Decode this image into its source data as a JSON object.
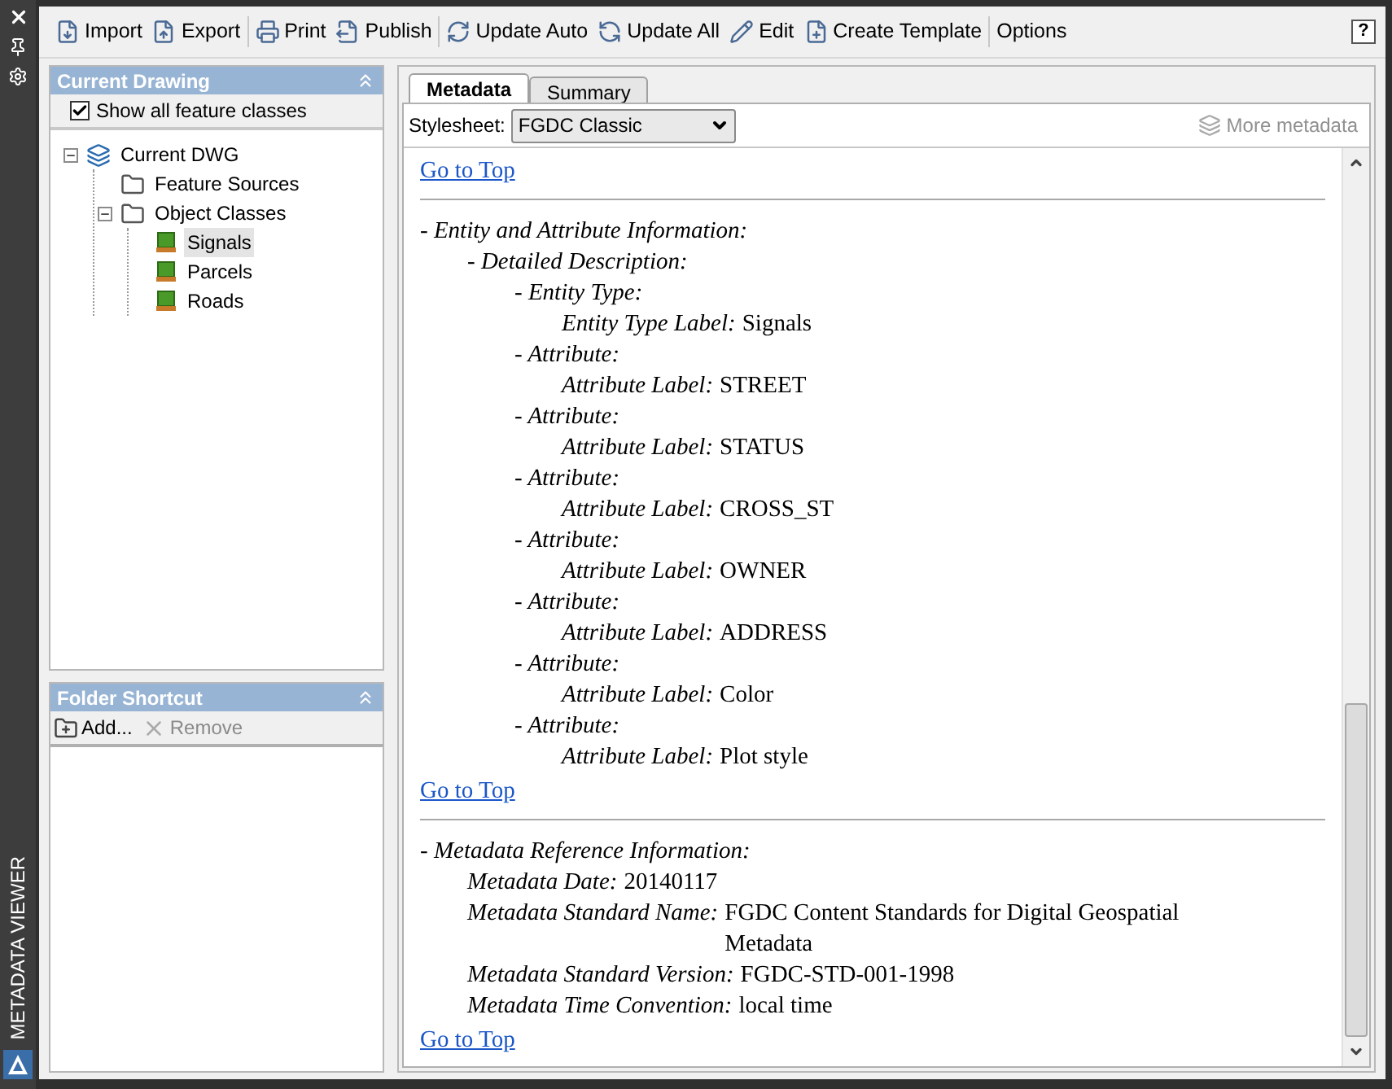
{
  "side_strip": {
    "title": "METADATA VIEWER"
  },
  "toolbar": {
    "groups": [
      [
        {
          "label": "Import"
        },
        {
          "label": "Export"
        }
      ],
      [
        {
          "label": "Print"
        },
        {
          "label": "Publish"
        }
      ],
      [
        {
          "label": "Update Auto"
        },
        {
          "label": "Update All"
        },
        {
          "label": "Edit"
        },
        {
          "label": "Create Template"
        }
      ],
      [
        {
          "label": "Options"
        }
      ]
    ],
    "help_button": "?"
  },
  "current_drawing": {
    "title": "Current Drawing",
    "show_all": {
      "label": "Show all feature classes",
      "checked": true
    },
    "tree": [
      {
        "label": "Current DWG",
        "kind": "drawing",
        "expanded": true,
        "selected": false,
        "children": [
          {
            "label": "Feature Sources",
            "kind": "folder",
            "selected": false
          },
          {
            "label": "Object Classes",
            "kind": "folder",
            "expanded": true,
            "selected": false,
            "children": [
              {
                "label": "Signals",
                "kind": "feature_class",
                "selected": true
              },
              {
                "label": "Parcels",
                "kind": "feature_class",
                "selected": false
              },
              {
                "label": "Roads",
                "kind": "feature_class",
                "selected": false
              }
            ]
          }
        ]
      }
    ]
  },
  "folder_shortcut": {
    "title": "Folder Shortcut",
    "buttons": [
      {
        "label": "Add...",
        "disabled": false
      },
      {
        "label": "Remove",
        "disabled": true
      }
    ]
  },
  "tabs": [
    {
      "label": "Metadata",
      "selected": true
    },
    {
      "label": "Summary",
      "selected": false
    }
  ],
  "stylesheet": {
    "label": "Stylesheet:",
    "value": "FGDC Classic"
  },
  "more_metadata": {
    "label": "More metadata",
    "disabled": true
  },
  "document": [
    {
      "kind": "link",
      "text": "Go to Top"
    },
    {
      "kind": "rule"
    },
    {
      "kind": "section",
      "label": "- Entity and Attribute Information:",
      "children": [
        {
          "label": "- Detailed Description:",
          "children": [
            {
              "label": "- Entity Type:",
              "children": [
                {
                  "label": "Entity Type Label:",
                  "value": "Signals"
                }
              ]
            },
            {
              "label": "- Attribute:",
              "children": [
                {
                  "label": "Attribute Label:",
                  "value": "STREET"
                }
              ]
            },
            {
              "label": "- Attribute:",
              "children": [
                {
                  "label": "Attribute Label:",
                  "value": "STATUS"
                }
              ]
            },
            {
              "label": "- Attribute:",
              "children": [
                {
                  "label": "Attribute Label:",
                  "value": "CROSS_ST"
                }
              ]
            },
            {
              "label": "- Attribute:",
              "children": [
                {
                  "label": "Attribute Label:",
                  "value": "OWNER"
                }
              ]
            },
            {
              "label": "- Attribute:",
              "children": [
                {
                  "label": "Attribute Label:",
                  "value": "ADDRESS"
                }
              ]
            },
            {
              "label": "- Attribute:",
              "children": [
                {
                  "label": "Attribute Label:",
                  "value": "Color"
                }
              ]
            },
            {
              "label": "- Attribute:",
              "children": [
                {
                  "label": "Attribute Label:",
                  "value": "Plot style"
                }
              ]
            }
          ]
        }
      ]
    },
    {
      "kind": "link",
      "text": "Go to Top"
    },
    {
      "kind": "rule"
    },
    {
      "kind": "section",
      "label": "- Metadata Reference Information:",
      "children": [
        {
          "label": "Metadata Date:",
          "value": "20140117"
        },
        {
          "label": "Metadata Standard Name:",
          "value": "FGDC Content Standards for Digital Geospatial Metadata"
        },
        {
          "label": "Metadata Standard Version:",
          "value": "FGDC-STD-001-1998"
        },
        {
          "label": "Metadata Time Convention:",
          "value": "local time"
        }
      ]
    },
    {
      "kind": "link",
      "text": "Go to Top"
    }
  ]
}
